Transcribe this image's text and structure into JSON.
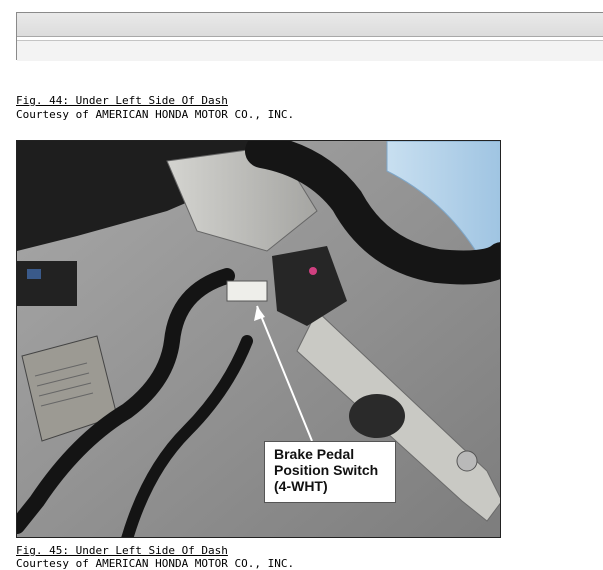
{
  "figures": [
    {
      "title": "Fig. 44: Under Left Side Of Dash",
      "credit": "Courtesy of AMERICAN HONDA MOTOR CO., INC."
    },
    {
      "title": "Fig. 45: Under Left Side Of Dash",
      "credit": "Courtesy of AMERICAN HONDA MOTOR CO., INC."
    }
  ],
  "photo": {
    "callout_lines": [
      "Brake Pedal",
      "Position Switch",
      "(4-WHT)"
    ]
  }
}
